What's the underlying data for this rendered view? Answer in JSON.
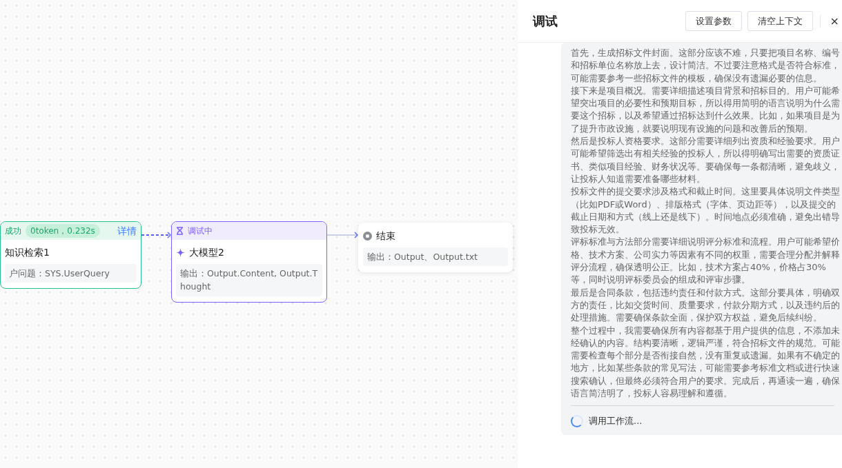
{
  "canvas": {
    "nodes": [
      {
        "kind": "success",
        "status": "成功",
        "badge": "0token，0.232s",
        "link": "详情",
        "title": "知识检索1",
        "detail": "户问题：SYS.UserQuery"
      },
      {
        "kind": "running",
        "status": "调试中",
        "title": "大模型2",
        "detail": "输出：Output.Content, Output.Thought"
      },
      {
        "kind": "end",
        "title": "结束",
        "detail": "输出：Output、Output.txt"
      }
    ],
    "edges": [
      {
        "kind": "dashed"
      },
      {
        "kind": "solid"
      }
    ]
  },
  "panel": {
    "title": "调试",
    "buttons": [
      "设置参数",
      "清空上下文"
    ],
    "close": "×",
    "message": {
      "paragraphs": [
        "首先，生成招标文件封面。这部分应该不难，只要把项目名称、编号和招标单位名称放上去，设计简洁。不过要注意格式是否符合标准，可能需要参考一些招标文件的模板，确保没有遗漏必要的信息。",
        "接下来是项目概况。需要详细描述项目背景和招标目的。用户可能希望突出项目的必要性和预期目标，所以得用简明的语言说明为什么需要这个招标，以及希望通过招标达到什么效果。比如，如果项目是为了提升市政设施，就要说明现有设施的问题和改善后的预期。",
        "然后是投标人资格要求。这部分需要详细列出资质和经验要求。用户可能希望筛选出有相关经验的投标人，所以得明确写出需要的资质证书、类似项目经验、财务状况等。要确保每一条都清晰，避免歧义，让投标人知道需要准备哪些材料。",
        "投标文件的提交要求涉及格式和截止时间。这里要具体说明文件类型（比如PDF或Word）、排版格式（字体、页边距等），以及提交的截止日期和方式（线上还是线下）。时间地点必须准确，避免出错导致投标无效。",
        "评标标准与方法部分需要详细说明评分标准和流程。用户可能希望价格、技术方案、公司实力等因素有不同的权重，需要合理分配并解释评分流程，确保透明公正。比如，技术方案占40%，价格占30%等，同时说明评标委员会的组成和评审步骤。",
        "最后是合同条款，包括违约责任和付款方式。这部分要具体，明确双方的责任，比如交货时间、质量要求，付款分期方式，以及违约后的处理措施。需要确保条款全面，保护双方权益，避免后续纠纷。",
        "整个过程中，我需要确保所有内容都基于用户提供的信息，不添加未经确认的内容。结构要清晰，逻辑严谨，符合招标文件的规范。可能需要检查每个部分是否衔接自然，没有重复或遗漏。如果有不确定的地方，比如某些条款的常见写法，可能需要参考标准文档或进行快速搜索确认，但最终必须符合用户的要求。完成后，再通读一遍，确保语言简洁明了，投标人容易理解和遵循。"
      ],
      "status": "调用工作流..."
    }
  }
}
